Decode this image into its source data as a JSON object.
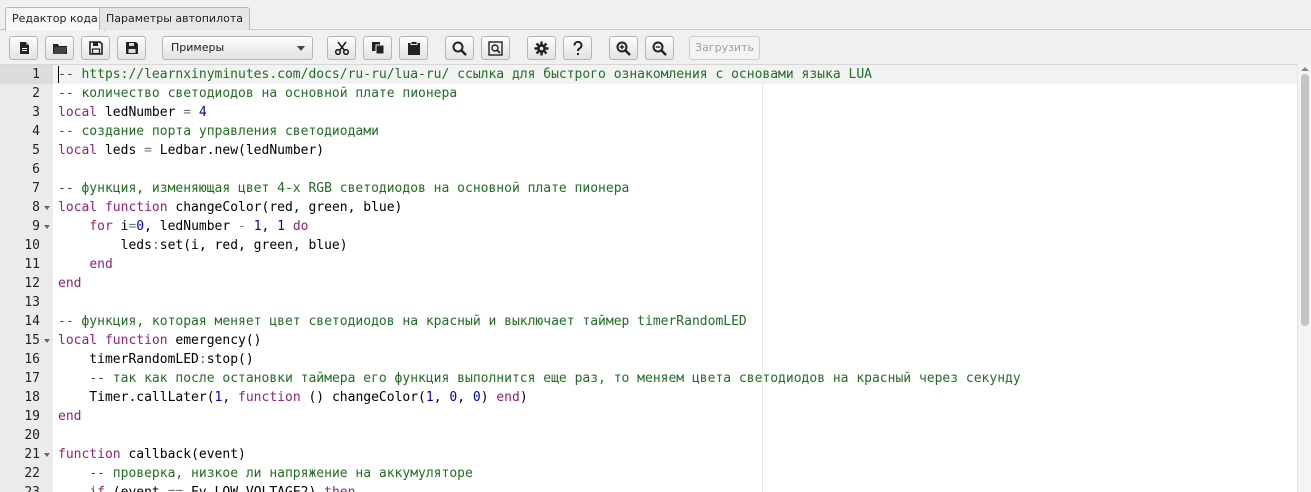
{
  "tabs": [
    {
      "label": "Редактор кода",
      "active": true
    },
    {
      "label": "Параметры автопилота",
      "active": false
    }
  ],
  "toolbar": {
    "examples_select": "Примеры",
    "load_button": "Загрузить",
    "buttons": [
      "new-file-icon",
      "open-folder-icon",
      "save-icon",
      "save-as-icon",
      "cut-icon",
      "copy-icon",
      "paste-icon",
      "search-icon",
      "find-replace-icon",
      "settings-icon",
      "help-icon",
      "zoom-in-icon",
      "zoom-out-icon"
    ]
  },
  "editor": {
    "active_line": 1,
    "lines": [
      {
        "n": "1",
        "fold": false,
        "tokens": [
          {
            "t": "comment",
            "v": "-- https://learnxinyminutes.com/docs/ru-ru/lua-ru/ ссылка для быстрого ознакомления с основами языка LUA"
          }
        ]
      },
      {
        "n": "2",
        "fold": false,
        "tokens": [
          {
            "t": "comment",
            "v": "-- количество светодиодов на основной плате пионера"
          }
        ]
      },
      {
        "n": "3",
        "fold": false,
        "tokens": [
          {
            "t": "kw",
            "v": "local"
          },
          {
            "t": "plain",
            "v": " ledNumber "
          },
          {
            "t": "op",
            "v": "="
          },
          {
            "t": "plain",
            "v": " "
          },
          {
            "t": "num",
            "v": "4"
          }
        ]
      },
      {
        "n": "4",
        "fold": false,
        "tokens": [
          {
            "t": "comment",
            "v": "-- создание порта управления светодиодами"
          }
        ]
      },
      {
        "n": "5",
        "fold": false,
        "tokens": [
          {
            "t": "kw",
            "v": "local"
          },
          {
            "t": "plain",
            "v": " leds "
          },
          {
            "t": "op",
            "v": "="
          },
          {
            "t": "plain",
            "v": " Ledbar.new(ledNumber)"
          }
        ]
      },
      {
        "n": "6",
        "fold": false,
        "tokens": []
      },
      {
        "n": "7",
        "fold": false,
        "tokens": [
          {
            "t": "comment",
            "v": "-- функция, изменяющая цвет 4-х RGB светодиодов на основной плате пионера"
          }
        ]
      },
      {
        "n": "8",
        "fold": true,
        "tokens": [
          {
            "t": "kw",
            "v": "local function"
          },
          {
            "t": "plain",
            "v": " changeColor(red, green, blue)"
          }
        ]
      },
      {
        "n": "9",
        "fold": true,
        "tokens": [
          {
            "t": "plain",
            "v": "    "
          },
          {
            "t": "kw",
            "v": "for"
          },
          {
            "t": "plain",
            "v": " i"
          },
          {
            "t": "op",
            "v": "="
          },
          {
            "t": "num",
            "v": "0"
          },
          {
            "t": "plain",
            "v": ", ledNumber "
          },
          {
            "t": "op",
            "v": "-"
          },
          {
            "t": "plain",
            "v": " "
          },
          {
            "t": "num",
            "v": "1"
          },
          {
            "t": "plain",
            "v": ", "
          },
          {
            "t": "num",
            "v": "1"
          },
          {
            "t": "plain",
            "v": " "
          },
          {
            "t": "kw",
            "v": "do"
          }
        ]
      },
      {
        "n": "10",
        "fold": false,
        "tokens": [
          {
            "t": "plain",
            "v": "        leds"
          },
          {
            "t": "op",
            "v": ":"
          },
          {
            "t": "plain",
            "v": "set(i, red, green, blue)"
          }
        ]
      },
      {
        "n": "11",
        "fold": false,
        "tokens": [
          {
            "t": "plain",
            "v": "    "
          },
          {
            "t": "kw",
            "v": "end"
          }
        ]
      },
      {
        "n": "12",
        "fold": false,
        "tokens": [
          {
            "t": "kw",
            "v": "end"
          }
        ]
      },
      {
        "n": "13",
        "fold": false,
        "tokens": []
      },
      {
        "n": "14",
        "fold": false,
        "tokens": [
          {
            "t": "comment",
            "v": "-- функция, которая меняет цвет светодиодов на красный и выключает таймер timerRandomLED"
          }
        ]
      },
      {
        "n": "15",
        "fold": true,
        "tokens": [
          {
            "t": "kw",
            "v": "local function"
          },
          {
            "t": "plain",
            "v": " emergency()"
          }
        ]
      },
      {
        "n": "16",
        "fold": false,
        "tokens": [
          {
            "t": "plain",
            "v": "    timerRandomLED"
          },
          {
            "t": "op",
            "v": ":"
          },
          {
            "t": "plain",
            "v": "stop()"
          }
        ]
      },
      {
        "n": "17",
        "fold": false,
        "tokens": [
          {
            "t": "plain",
            "v": "    "
          },
          {
            "t": "comment",
            "v": "-- так как после остановки таймера его функция выполнится еще раз, то меняем цвета светодиодов на красный через секунду"
          }
        ]
      },
      {
        "n": "18",
        "fold": false,
        "tokens": [
          {
            "t": "plain",
            "v": "    Timer.callLater("
          },
          {
            "t": "num",
            "v": "1"
          },
          {
            "t": "plain",
            "v": ", "
          },
          {
            "t": "kw",
            "v": "function"
          },
          {
            "t": "plain",
            "v": " () changeColor("
          },
          {
            "t": "num",
            "v": "1"
          },
          {
            "t": "plain",
            "v": ", "
          },
          {
            "t": "num",
            "v": "0"
          },
          {
            "t": "plain",
            "v": ", "
          },
          {
            "t": "num",
            "v": "0"
          },
          {
            "t": "plain",
            "v": ") "
          },
          {
            "t": "kw",
            "v": "end"
          },
          {
            "t": "plain",
            "v": ")"
          }
        ]
      },
      {
        "n": "19",
        "fold": false,
        "tokens": [
          {
            "t": "kw",
            "v": "end"
          }
        ]
      },
      {
        "n": "20",
        "fold": false,
        "tokens": []
      },
      {
        "n": "21",
        "fold": true,
        "tokens": [
          {
            "t": "kw",
            "v": "function"
          },
          {
            "t": "plain",
            "v": " callback(event)"
          }
        ]
      },
      {
        "n": "22",
        "fold": false,
        "tokens": [
          {
            "t": "plain",
            "v": "    "
          },
          {
            "t": "comment",
            "v": "-- проверка, низкое ли напряжение на аккумуляторе"
          }
        ]
      },
      {
        "n": "23",
        "fold": false,
        "tokens": [
          {
            "t": "plain",
            "v": "    "
          },
          {
            "t": "kw",
            "v": "if"
          },
          {
            "t": "plain",
            "v": " (event "
          },
          {
            "t": "op",
            "v": "=="
          },
          {
            "t": "plain",
            "v": " Ev.LOW_VOLTAGE2) "
          },
          {
            "t": "kw",
            "v": "then"
          }
        ]
      }
    ]
  }
}
